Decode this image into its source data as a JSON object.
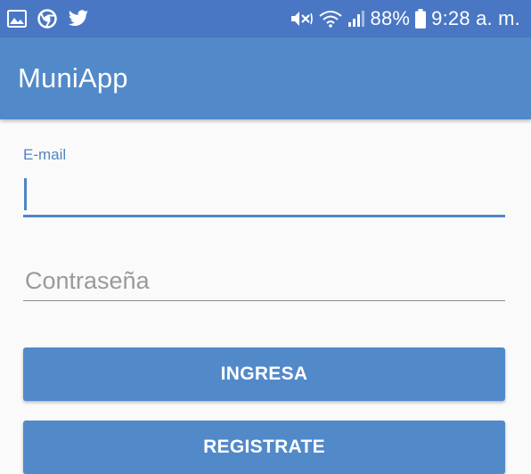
{
  "status_bar": {
    "left_icons": [
      "gallery-icon",
      "chrome-icon",
      "twitter-icon"
    ],
    "right_icons": [
      "mute-vibrate-icon",
      "wifi-icon",
      "signal-icon",
      "battery-icon"
    ],
    "battery": "88%",
    "time": "9:28 a. m.",
    "background": "#4a77c4"
  },
  "app_bar": {
    "title": "MuniApp",
    "background": "#5289c9"
  },
  "form": {
    "email": {
      "label": "E-mail",
      "value": "",
      "accent": "#4f85c6"
    },
    "password": {
      "placeholder": "Contraseña",
      "value": ""
    },
    "login_label": "INGRESA",
    "register_label": "REGISTRATE"
  }
}
